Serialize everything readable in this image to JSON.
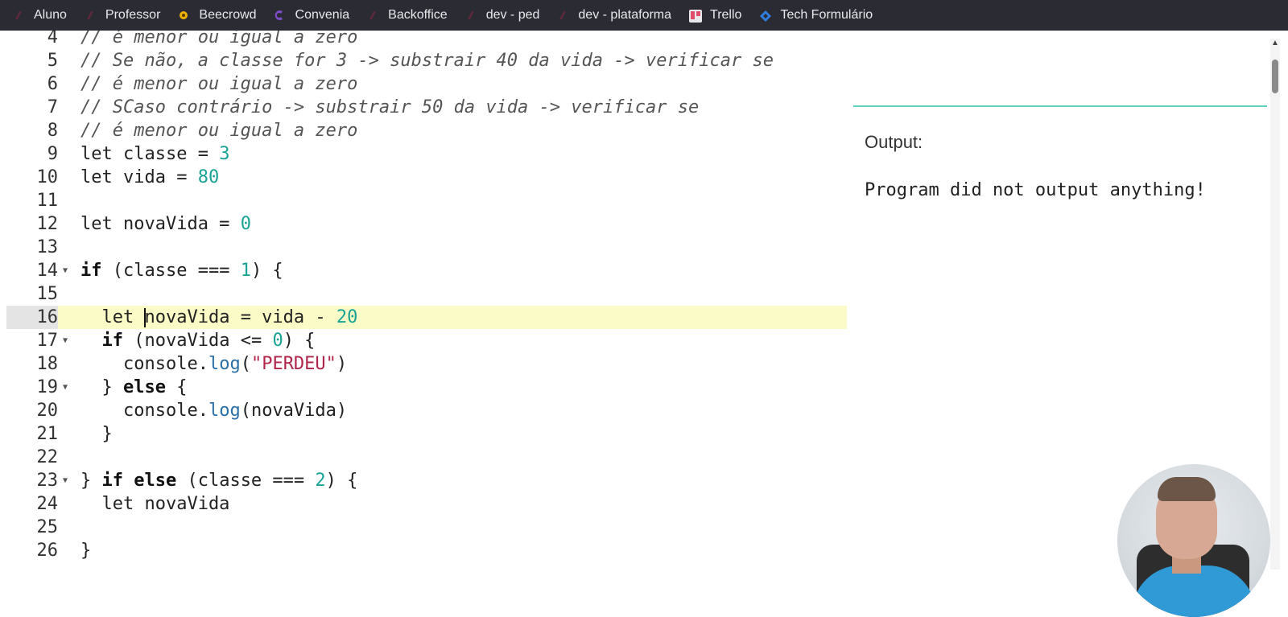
{
  "bookmarks": [
    {
      "label": "Aluno",
      "icon": "bookmark-dark-icon"
    },
    {
      "label": "Professor",
      "icon": "bookmark-dark-icon"
    },
    {
      "label": "Beecrowd",
      "icon": "beecrowd-icon"
    },
    {
      "label": "Convenia",
      "icon": "convenia-icon"
    },
    {
      "label": "Backoffice",
      "icon": "bookmark-dark-icon"
    },
    {
      "label": "dev - ped",
      "icon": "bookmark-dark-icon"
    },
    {
      "label": "dev - plataforma",
      "icon": "bookmark-dark-icon"
    },
    {
      "label": "Trello",
      "icon": "trello-icon"
    },
    {
      "label": "Tech Formulário",
      "icon": "jira-icon"
    }
  ],
  "editor": {
    "lines": [
      {
        "n": "4",
        "fold": false,
        "tokens": [
          {
            "t": "// é menor ou igual a zero",
            "c": "comment"
          }
        ]
      },
      {
        "n": "5",
        "fold": false,
        "tokens": [
          {
            "t": "// Se não, a classe for 3 -> substrair 40 da vida -> verificar se",
            "c": "comment"
          }
        ]
      },
      {
        "n": "6",
        "fold": false,
        "tokens": [
          {
            "t": "// é menor ou igual a zero",
            "c": "comment"
          }
        ]
      },
      {
        "n": "7",
        "fold": false,
        "tokens": [
          {
            "t": "// SCaso contrário -> substrair 50 da vida -> verificar se",
            "c": "comment"
          }
        ]
      },
      {
        "n": "8",
        "fold": false,
        "tokens": [
          {
            "t": "// é menor ou igual a zero",
            "c": "comment"
          }
        ]
      },
      {
        "n": "9",
        "fold": false,
        "tokens": [
          {
            "t": "let classe = ",
            "c": "plain"
          },
          {
            "t": "3",
            "c": "num"
          }
        ]
      },
      {
        "n": "10",
        "fold": false,
        "tokens": [
          {
            "t": "let vida = ",
            "c": "plain"
          },
          {
            "t": "80",
            "c": "num"
          }
        ]
      },
      {
        "n": "11",
        "fold": false,
        "tokens": []
      },
      {
        "n": "12",
        "fold": false,
        "tokens": [
          {
            "t": "let novaVida = ",
            "c": "plain"
          },
          {
            "t": "0",
            "c": "num"
          }
        ]
      },
      {
        "n": "13",
        "fold": false,
        "tokens": []
      },
      {
        "n": "14",
        "fold": true,
        "tokens": [
          {
            "t": "if",
            "c": "kw"
          },
          {
            "t": " (classe === ",
            "c": "plain"
          },
          {
            "t": "1",
            "c": "num"
          },
          {
            "t": ") {",
            "c": "plain"
          }
        ]
      },
      {
        "n": "15",
        "fold": false,
        "tokens": []
      },
      {
        "n": "16",
        "fold": false,
        "active": true,
        "tokens": [
          {
            "t": "  let ",
            "c": "plain"
          },
          {
            "t": "",
            "c": "cursor"
          },
          {
            "t": "novaVida = vida - ",
            "c": "plain"
          },
          {
            "t": "20",
            "c": "num"
          }
        ]
      },
      {
        "n": "17",
        "fold": true,
        "tokens": [
          {
            "t": "  ",
            "c": "plain"
          },
          {
            "t": "if",
            "c": "kw"
          },
          {
            "t": " (novaVida <= ",
            "c": "plain"
          },
          {
            "t": "0",
            "c": "num"
          },
          {
            "t": ") {",
            "c": "plain"
          }
        ]
      },
      {
        "n": "18",
        "fold": false,
        "tokens": [
          {
            "t": "    console.",
            "c": "plain"
          },
          {
            "t": "log",
            "c": "fn"
          },
          {
            "t": "(",
            "c": "plain"
          },
          {
            "t": "\"PERDEU\"",
            "c": "str"
          },
          {
            "t": ")",
            "c": "plain"
          }
        ]
      },
      {
        "n": "19",
        "fold": true,
        "tokens": [
          {
            "t": "  } ",
            "c": "plain"
          },
          {
            "t": "else",
            "c": "kw"
          },
          {
            "t": " {",
            "c": "plain"
          }
        ]
      },
      {
        "n": "20",
        "fold": false,
        "tokens": [
          {
            "t": "    console.",
            "c": "plain"
          },
          {
            "t": "log",
            "c": "fn"
          },
          {
            "t": "(novaVida)",
            "c": "plain"
          }
        ]
      },
      {
        "n": "21",
        "fold": false,
        "tokens": [
          {
            "t": "  }",
            "c": "plain"
          }
        ]
      },
      {
        "n": "22",
        "fold": false,
        "tokens": []
      },
      {
        "n": "23",
        "fold": true,
        "tokens": [
          {
            "t": "} ",
            "c": "plain"
          },
          {
            "t": "if else",
            "c": "kw"
          },
          {
            "t": " (classe === ",
            "c": "plain"
          },
          {
            "t": "2",
            "c": "num"
          },
          {
            "t": ") {",
            "c": "plain"
          }
        ]
      },
      {
        "n": "24",
        "fold": false,
        "tokens": [
          {
            "t": "  let novaVida",
            "c": "plain"
          }
        ]
      },
      {
        "n": "25",
        "fold": false,
        "tokens": []
      },
      {
        "n": "26",
        "fold": false,
        "tokens": [
          {
            "t": "}",
            "c": "plain"
          }
        ]
      }
    ]
  },
  "output": {
    "label": "Output:",
    "text": "Program did not output anything!"
  },
  "colors": {
    "bookmarks_bg": "#2b2b34",
    "active_line": "#fbfbc8",
    "number": "#1aa394",
    "string": "#b0254a",
    "function": "#2a6fa8",
    "divider": "#5ed3c3"
  }
}
